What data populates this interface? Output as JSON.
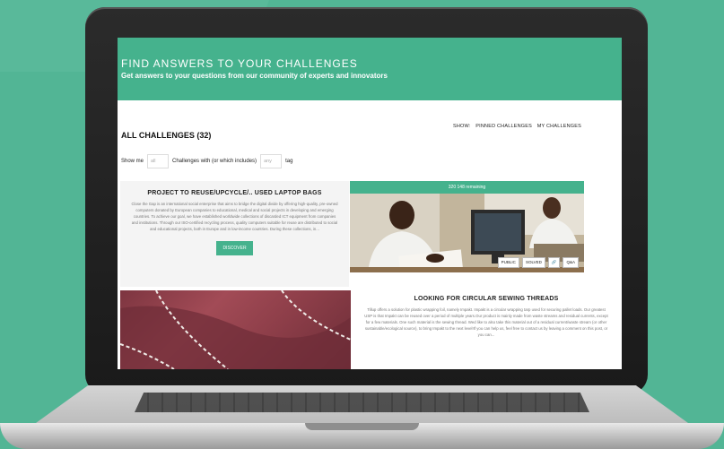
{
  "hero": {
    "title": "FIND ANSWERS TO YOUR CHALLENGES",
    "subtitle": "Get answers to your questions from our community of experts and innovators"
  },
  "list": {
    "title": "ALL CHALLENGES (32)",
    "show_label": "SHOW:",
    "pinned_link": "PINNED CHALLENGES",
    "my_link": "MY CHALLENGES"
  },
  "filter": {
    "show_me": "Show me",
    "all_placeholder": "all",
    "middle_text": "Challenges with (or which includes)",
    "any_placeholder": "any",
    "tag": "tag"
  },
  "cards": [
    {
      "title": "PROJECT TO REUSE/UPCYCLE/.. USED LAPTOP BAGS",
      "description": "Close the Gap is an international social enterprise that aims to bridge the digital divide by offering high-quality, pre-owned computers donated by European companies to educational, medical and social projects in developing and emerging countries. To achieve our goal, we have established worldwide collections of discarded ICT equipment from companies and institutions. Through our ISO-certified recycling process, quality computers suitable for reuse are distributed to social and educational projects, both in Europe and in low-income countries. During these collections, in...",
      "button": "DISCOVER",
      "remaining": "320 148 remaining",
      "tags": [
        "PUBLIC",
        "SOLVED",
        "🔗",
        "Q&A"
      ]
    },
    {
      "title": "LOOKING FOR CIRCULAR SEWING THREADS",
      "description": "Tillup offers a solution for plastic wrapping foil, namely Impakt. Impakt is a circular wrapping tarp used for securing pallet loads. Our greatest USP is that Impakt can be reused over a period of multiple years.Our product is mainly made from waste streams and residual currents, except for a few materials. One such material is the sewing thread. Wed like to also take this material out of a residual current/waste stream (or other sustainable/ecological source), to bring Impakt to the next level!If you can help us, feel free to contact us by leaving a comment on this post, or you can..."
    }
  ],
  "colors": {
    "accent": "#45b28d",
    "background": "#52b595"
  }
}
